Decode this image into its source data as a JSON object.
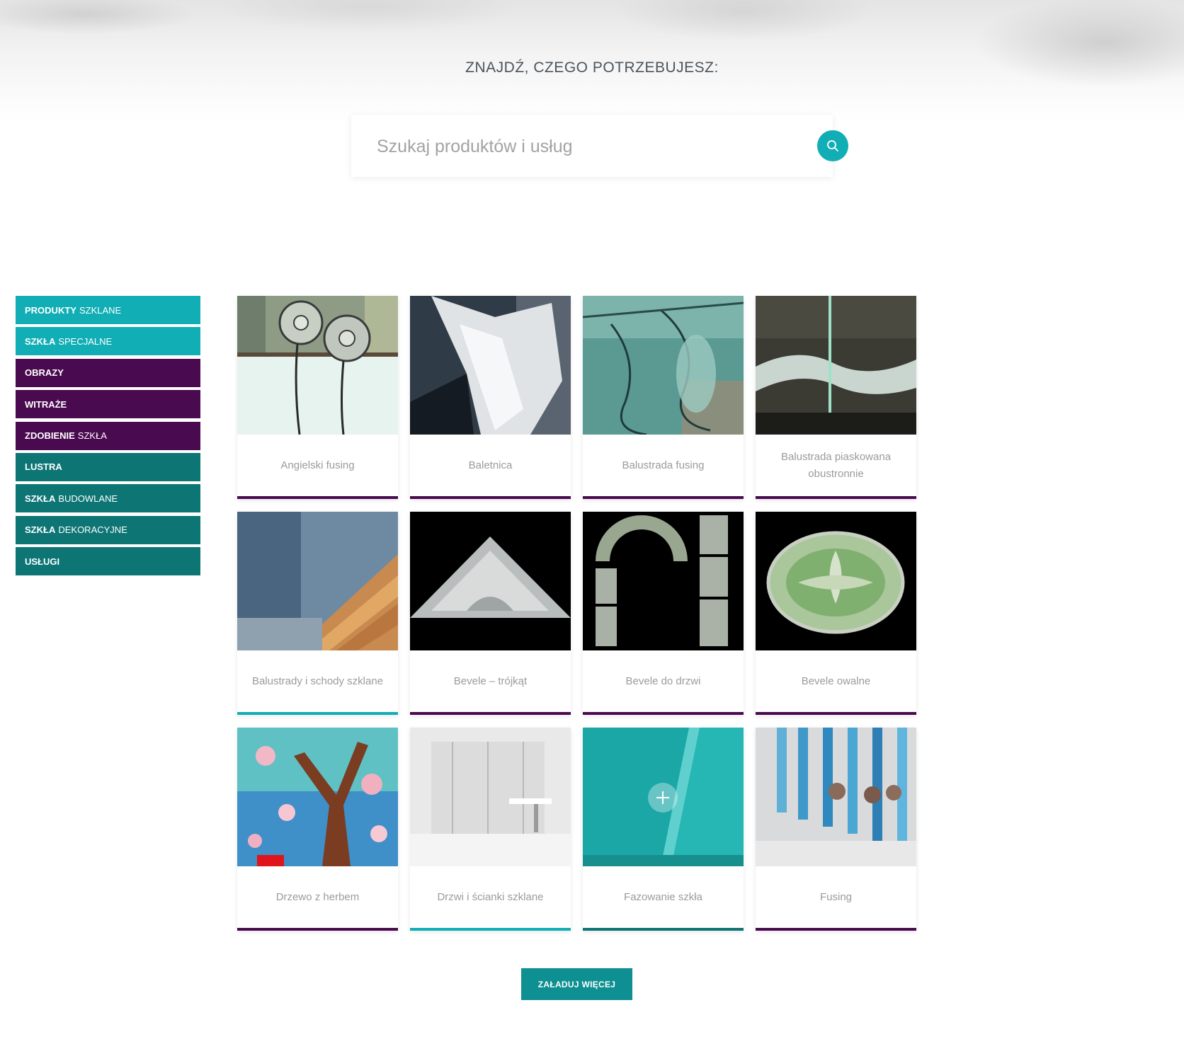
{
  "header": {
    "title": "ZNAJDŹ, CZEGO POTRZEBUJESZ:"
  },
  "search": {
    "placeholder": "Szukaj produktów i usług",
    "icon": "search-icon"
  },
  "colors": {
    "teal": "#12aeb5",
    "purple": "#4a0a4f",
    "dark_teal": "#0e7575",
    "button": "#0e8f91"
  },
  "sidebar": {
    "items": [
      {
        "bold": "PRODUKTY",
        "light": "SZKLANE",
        "color": "#12aeb5"
      },
      {
        "bold": "SZKŁA",
        "light": "SPECJALNE",
        "color": "#12aeb5"
      },
      {
        "bold": "OBRAZY",
        "light": "",
        "color": "#4a0a4f"
      },
      {
        "bold": "WITRAŻE",
        "light": "",
        "color": "#4a0a4f"
      },
      {
        "bold": "ZDOBIENIE",
        "light": "SZKŁA",
        "color": "#4a0a4f"
      },
      {
        "bold": "LUSTRA",
        "light": "",
        "color": "#0e7575"
      },
      {
        "bold": "SZKŁA",
        "light": "BUDOWLANE",
        "color": "#0e7575"
      },
      {
        "bold": "SZKŁA",
        "light": "DEKORACYJNE",
        "color": "#0e7575"
      },
      {
        "bold": "USŁUGI",
        "light": "",
        "color": "#0e7575"
      }
    ]
  },
  "products": [
    {
      "caption": "Angielski fusing",
      "accent": "#4a0a4f"
    },
    {
      "caption": "Baletnica",
      "accent": "#4a0a4f"
    },
    {
      "caption": "Balustrada fusing",
      "accent": "#4a0a4f"
    },
    {
      "caption": "Balustrada piaskowana obustronnie",
      "accent": "#4a0a4f"
    },
    {
      "caption": "Balustrady i schody szklane",
      "accent": "#12aeb5"
    },
    {
      "caption": "Bevele – trójkąt",
      "accent": "#4a0a4f"
    },
    {
      "caption": "Bevele do drzwi",
      "accent": "#4a0a4f"
    },
    {
      "caption": "Bevele owalne",
      "accent": "#4a0a4f"
    },
    {
      "caption": "Drzewo z herbem",
      "accent": "#4a0a4f"
    },
    {
      "caption": "Drzwi i ścianki szklane",
      "accent": "#12aeb5"
    },
    {
      "caption": "Fazowanie szkła",
      "accent": "#0e7575"
    },
    {
      "caption": "Fusing",
      "accent": "#4a0a4f"
    }
  ],
  "load_more": {
    "label": "ZAŁADUJ WIĘCEJ"
  }
}
